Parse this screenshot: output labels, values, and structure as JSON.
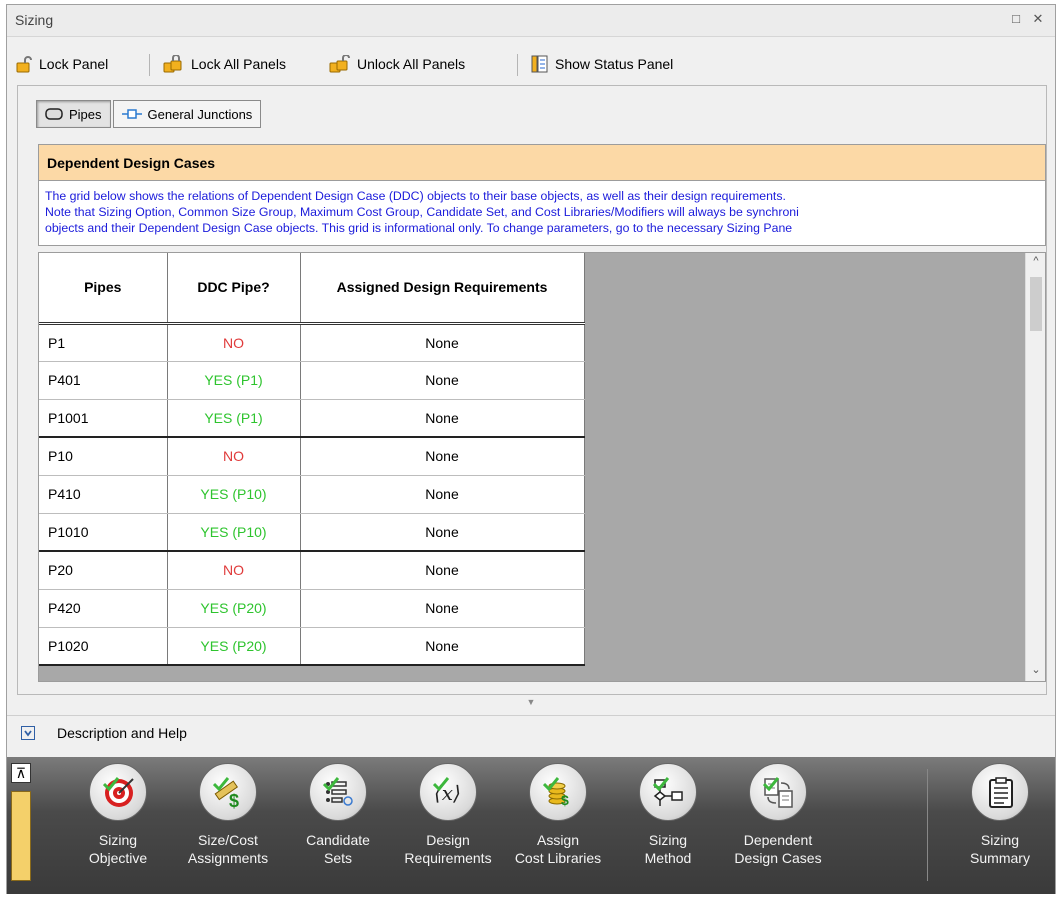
{
  "window": {
    "title": "Sizing"
  },
  "toolbar": {
    "lock_panel": "Lock Panel",
    "lock_all": "Lock All Panels",
    "unlock_all": "Unlock All Panels",
    "show_status": "Show Status Panel"
  },
  "tabs": [
    {
      "label": "Pipes",
      "active": true
    },
    {
      "label": "General Junctions",
      "active": false
    }
  ],
  "ddc": {
    "header": "Dependent Design Cases",
    "desc_line1": "The grid below shows the relations of Dependent Design Case (DDC) objects to their base objects, as well as their design requirements.",
    "desc_line2": "Note that Sizing Option, Common Size Group, Maximum Cost Group, Candidate Set, and Cost Libraries/Modifiers will always be synchroni",
    "desc_line3": "objects and their Dependent Design Case objects. This grid is informational only. To change parameters, go to the necessary Sizing Pane"
  },
  "grid": {
    "columns": [
      "Pipes",
      "DDC Pipe?",
      "Assigned Design Requirements"
    ],
    "rows": [
      {
        "pipe": "P1",
        "ddc": "NO",
        "req": "None"
      },
      {
        "pipe": "P401",
        "ddc": "YES (P1)",
        "req": "None"
      },
      {
        "pipe": "P1001",
        "ddc": "YES (P1)",
        "req": "None"
      },
      {
        "pipe": "P10",
        "ddc": "NO",
        "req": "None"
      },
      {
        "pipe": "P410",
        "ddc": "YES (P10)",
        "req": "None"
      },
      {
        "pipe": "P1010",
        "ddc": "YES (P10)",
        "req": "None"
      },
      {
        "pipe": "P20",
        "ddc": "NO",
        "req": "None"
      },
      {
        "pipe": "P420",
        "ddc": "YES (P20)",
        "req": "None"
      },
      {
        "pipe": "P1020",
        "ddc": "YES (P20)",
        "req": "None"
      }
    ]
  },
  "colors": {
    "no": "#e03a3a",
    "yes": "#2ec42e",
    "header_bg": "#fcd9a6",
    "desc_text": "#1b1bdb"
  },
  "description_help": "Description and Help",
  "nav": {
    "sizing_objective": [
      "Sizing",
      "Objective"
    ],
    "size_cost": [
      "Size/Cost",
      "Assignments"
    ],
    "candidate_sets": [
      "Candidate",
      "Sets"
    ],
    "design_req": [
      "Design",
      "Requirements"
    ],
    "assign_cost": [
      "Assign",
      "Cost Libraries"
    ],
    "sizing_method": [
      "Sizing",
      "Method"
    ],
    "dependent": [
      "Dependent",
      "Design Cases"
    ],
    "summary": [
      "Sizing",
      "Summary"
    ]
  }
}
